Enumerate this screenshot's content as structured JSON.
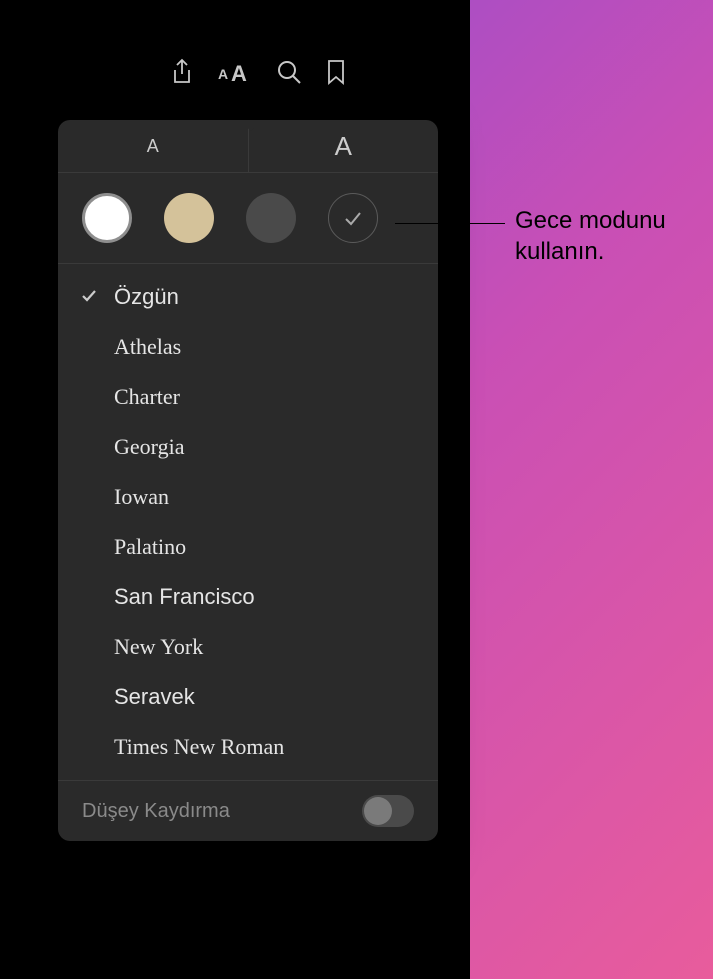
{
  "toolbar": {
    "icons": [
      "share-icon",
      "appearance-icon",
      "search-icon",
      "bookmark-icon"
    ]
  },
  "popover": {
    "size_small": "A",
    "size_large": "A",
    "themes": {
      "white": "#ffffff",
      "sepia": "#d4c29a",
      "gray": "#4a4a4a",
      "night": "#2a2a2a",
      "night_selected": true
    },
    "fonts": [
      {
        "label": "Özgün",
        "class": "",
        "selected": true
      },
      {
        "label": "Athelas",
        "class": "font-athelas",
        "selected": false
      },
      {
        "label": "Charter",
        "class": "font-charter",
        "selected": false
      },
      {
        "label": "Georgia",
        "class": "font-georgia",
        "selected": false
      },
      {
        "label": "Iowan",
        "class": "font-iowan",
        "selected": false
      },
      {
        "label": "Palatino",
        "class": "font-palatino",
        "selected": false
      },
      {
        "label": "San Francisco",
        "class": "font-sf",
        "selected": false
      },
      {
        "label": "New York",
        "class": "font-ny",
        "selected": false
      },
      {
        "label": "Seravek",
        "class": "font-seravek",
        "selected": false
      },
      {
        "label": "Times New Roman",
        "class": "font-tnr",
        "selected": false
      }
    ],
    "scroll": {
      "label": "Düşey Kaydırma",
      "enabled": false
    }
  },
  "callout": {
    "text": "Gece modunu kullanın."
  }
}
